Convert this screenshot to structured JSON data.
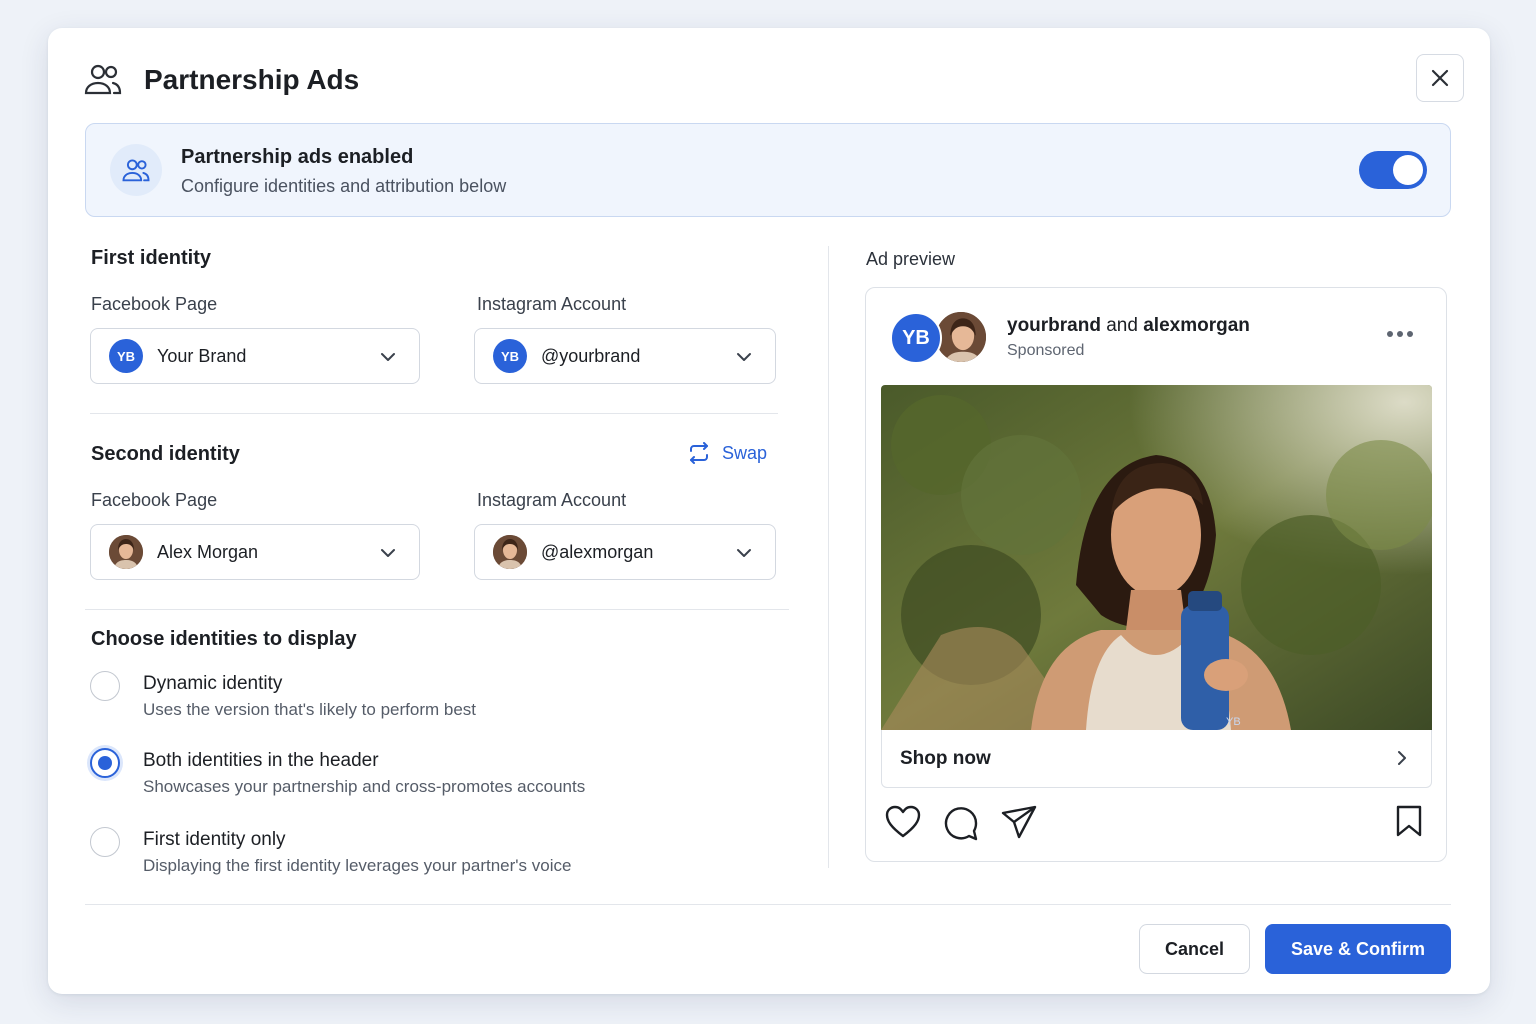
{
  "dialog": {
    "title": "Partnership Ads",
    "close_icon": "close-icon"
  },
  "banner": {
    "title": "Partnership ads enabled",
    "subtitle": "Configure identities and attribution below",
    "toggle_on": true
  },
  "first_identity": {
    "title": "First identity",
    "facebook_label": "Facebook Page",
    "facebook_value": "Your Brand",
    "facebook_avatar": "YB",
    "instagram_label": "Instagram Account",
    "instagram_value": "@yourbrand",
    "instagram_avatar": "YB"
  },
  "second_identity": {
    "title": "Second identity",
    "swap_label": "Swap",
    "facebook_label": "Facebook Page",
    "facebook_value": "Alex Morgan",
    "instagram_label": "Instagram Account",
    "instagram_value": "@alexmorgan"
  },
  "display_choice": {
    "title": "Choose identities to display",
    "options": [
      {
        "title": "Dynamic identity",
        "description": "Uses the version that's likely to perform best",
        "selected": false
      },
      {
        "title": "Both identities in the header",
        "description": "Showcases your partnership and cross-promotes accounts",
        "selected": true
      },
      {
        "title": "First identity only",
        "description": "Displaying the first identity leverages your partner's voice",
        "selected": false
      }
    ]
  },
  "preview": {
    "label": "Ad preview",
    "avatar_initials": "YB",
    "brand": "yourbrand",
    "connector": "and",
    "partner": "alexmorgan",
    "sponsored": "Sponsored",
    "cta": "Shop now",
    "bottle_mark": "YB"
  },
  "footer": {
    "cancel_label": "Cancel",
    "save_label": "Save & Confirm"
  },
  "colors": {
    "accent": "#2a62d9",
    "banner_bg": "#f0f5fd"
  }
}
